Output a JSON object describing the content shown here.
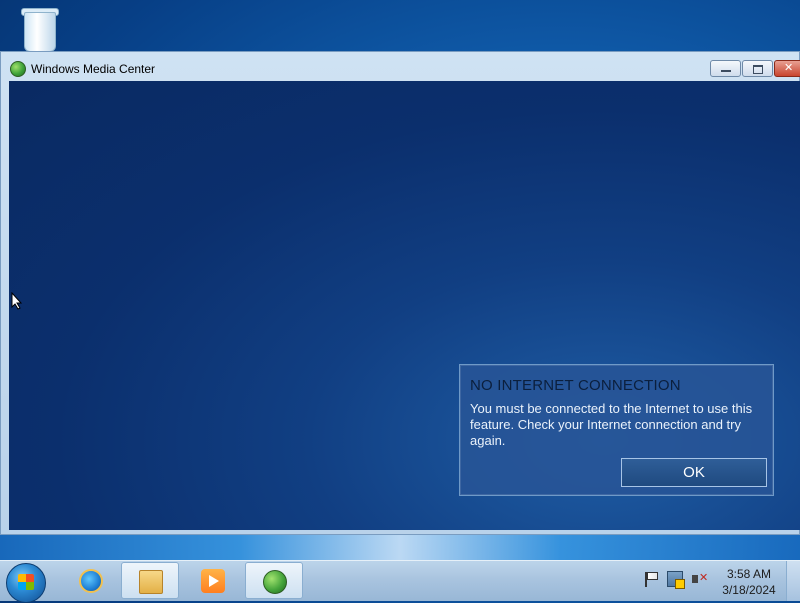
{
  "desktop": {
    "recycle_bin_icon": "recycle-bin-icon"
  },
  "window": {
    "title": "Windows Media Center",
    "buttons": [
      "minimize",
      "maximize",
      "close"
    ]
  },
  "dialog": {
    "title": "NO INTERNET CONNECTION",
    "message": "You must be connected to the Internet to use this feature. Check your Internet connection and try again.",
    "ok_label": "OK"
  },
  "taskbar": {
    "items": [
      "start",
      "internet-explorer",
      "windows-explorer",
      "windows-media-player",
      "windows-media-center"
    ],
    "clock_time": "3:58 AM",
    "clock_date": "3/18/2024"
  }
}
